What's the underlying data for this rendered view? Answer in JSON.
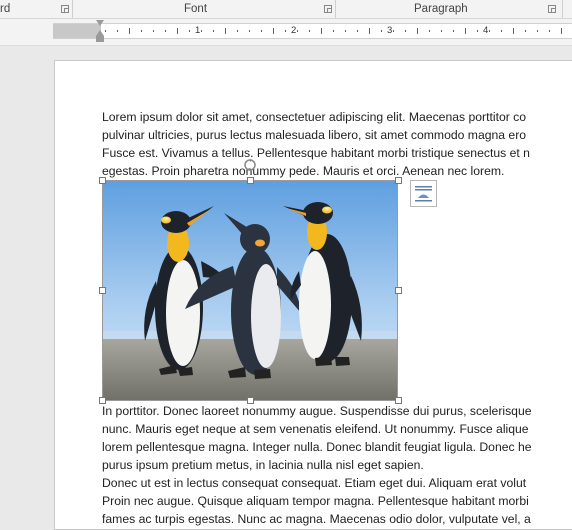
{
  "ribbon": {
    "groups": [
      {
        "name": "clipboard",
        "label": "rd"
      },
      {
        "name": "font",
        "label": "Font"
      },
      {
        "name": "paragraph",
        "label": "Paragraph"
      }
    ]
  },
  "ruler": {
    "numbers": [
      "1",
      "2",
      "3",
      "4"
    ]
  },
  "document": {
    "lines_before_image": [
      "Lorem ipsum dolor sit amet, consectetuer adipiscing elit. Maecenas porttitor co",
      "pulvinar ultricies, purus lectus malesuada libero, sit amet commodo magna ero",
      "Fusce est. Vivamus a tellus. Pellentesque habitant morbi tristique senectus et n",
      "egestas. Proin pharetra nonummy pede. Mauris et orci. Aenean nec lorem."
    ],
    "lines_after_image": [
      "In porttitor. Donec laoreet nonummy augue. Suspendisse dui purus, scelerisque",
      "nunc. Mauris eget neque at sem venenatis eleifend. Ut nonummy. Fusce alique",
      "lorem pellentesque magna. Integer nulla. Donec blandit feugiat ligula. Donec he",
      "purus ipsum pretium metus, in lacinia nulla nisl eget sapien.",
      "Donec ut est in lectus consequat consequat. Etiam eget dui. Aliquam erat volut",
      "Proin nec augue. Quisque aliquam tempor magna. Pellentesque habitant morbi",
      "fames ac turpis egestas. Nunc ac magna. Maecenas odio dolor, vulputate vel, a"
    ],
    "image": {
      "subject": "penguins",
      "selected": true
    }
  },
  "colors": {
    "sky_top": "#5f9fe0",
    "sky_bottom": "#d8e9f7",
    "ground": "#8a8a84",
    "ruler_margin": "#c8c8c8"
  },
  "icons": {
    "rotate": "rotate-handle-icon",
    "layout_options": "layout-options-icon",
    "dialog_launcher": "dialog-launcher-icon"
  }
}
